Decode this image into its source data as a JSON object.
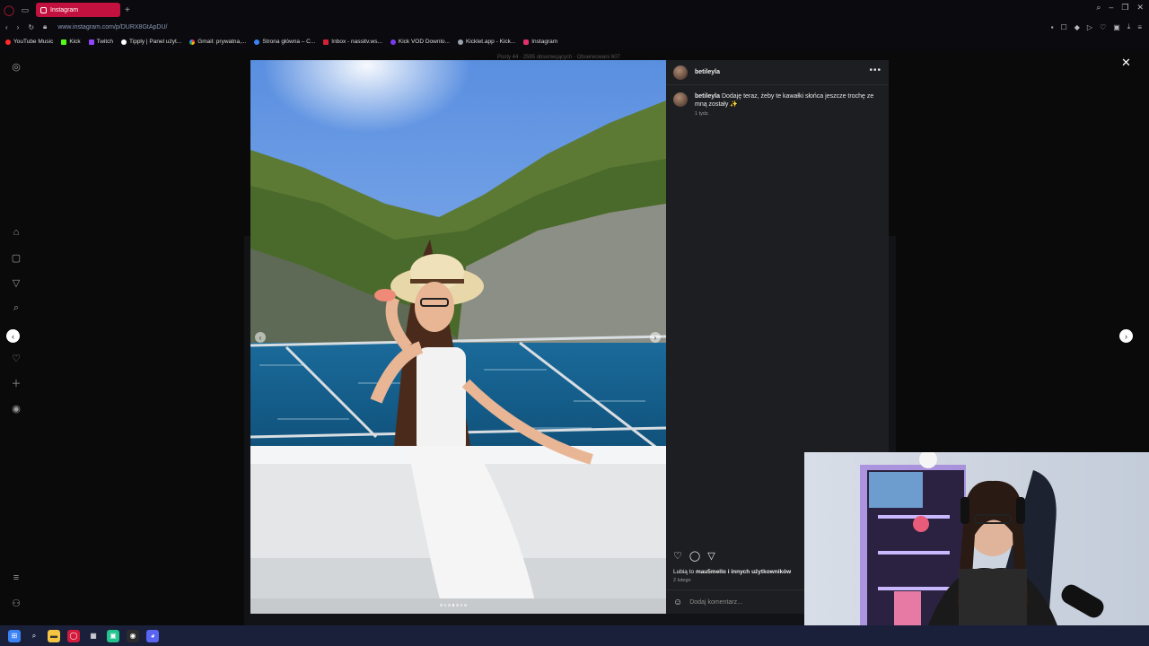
{
  "browser": {
    "tab_title": "Instagram",
    "url": "www.instagram.com/p/DURX8GtApDU/",
    "bookmarks": [
      {
        "label": "YouTube Music",
        "color": "#ff2b2b"
      },
      {
        "label": "Kick",
        "color": "#53fc18"
      },
      {
        "label": "Twitch",
        "color": "#9146ff"
      },
      {
        "label": "Tipply | Panel użyt...",
        "color": "#ffffff"
      },
      {
        "label": "Gmail: prywatna,...",
        "color": "#ea4335"
      },
      {
        "label": "Strona główna – C...",
        "color": "#3b82f6"
      },
      {
        "label": "Inbox - nassitv.ws...",
        "color": "#d61f3b"
      },
      {
        "label": "Kick VOD Downlo...",
        "color": "#7c3aed"
      },
      {
        "label": "Kicklet.app - Kick...",
        "color": "#9ca3af"
      },
      {
        "label": "Instagram",
        "color": "#e1306c"
      }
    ]
  },
  "background_text": "Posty 44 · 2585 obserwujących · Obserwowani 607",
  "post": {
    "username": "betileyla",
    "caption": "Dodaję teraz, żeby te kawałki słońca jeszcze trochę ze mną zostały ✨",
    "time_ago": "1 tydz.",
    "likes_prefix": "Lubią to ",
    "likes_user": "mau5mello",
    "likes_suffix": " i innych użytkowników",
    "date": "2 lutego",
    "comment_placeholder": "Dodaj komentarz..."
  }
}
